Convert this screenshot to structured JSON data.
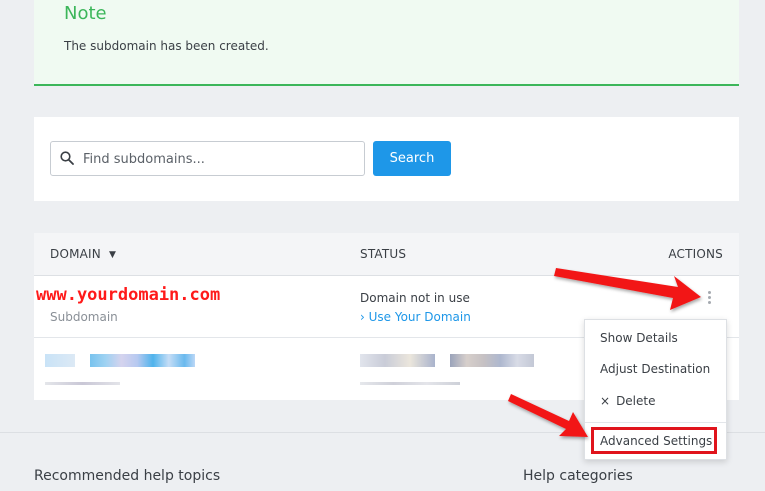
{
  "note": {
    "title": "Note",
    "message": "The subdomain has been created."
  },
  "search": {
    "placeholder": "Find subdomains...",
    "button_label": "Search"
  },
  "table": {
    "columns": {
      "domain": "DOMAIN",
      "status": "STATUS",
      "actions": "ACTIONS"
    },
    "rows": [
      {
        "domain": "www.yourdomain.com",
        "type": "Subdomain",
        "status": "Domain not in use",
        "status_link": "› Use Your Domain"
      }
    ]
  },
  "actions_menu": {
    "items": [
      {
        "label": "Show Details"
      },
      {
        "label": "Adjust Destination"
      },
      {
        "label": "Delete",
        "icon": "×"
      },
      {
        "label": "Advanced Settings"
      }
    ]
  },
  "footer": {
    "recommended_help_topics": "Recommended help topics",
    "help_categories": "Help categories"
  },
  "colors": {
    "accent_blue": "#1e97e8",
    "note_green": "#3cb65a",
    "annotation_red": "#e0141c"
  },
  "icons": {
    "search": "search-icon",
    "sort": "caret-down-icon",
    "more": "kebab-menu-icon",
    "delete": "close-icon"
  }
}
